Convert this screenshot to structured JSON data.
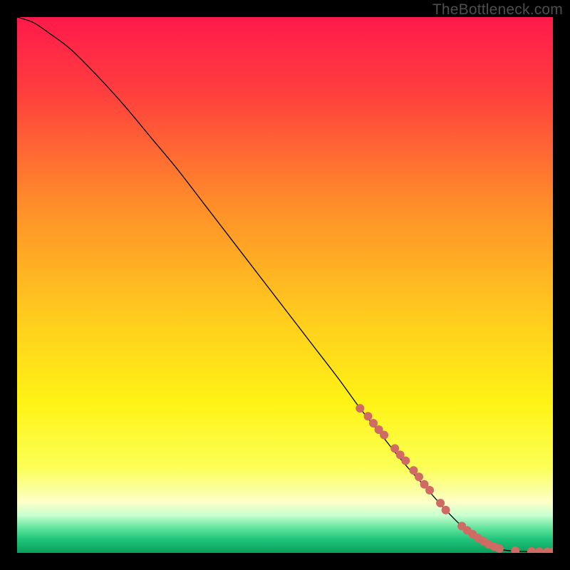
{
  "branding": {
    "watermark": "TheBottleneck.com"
  },
  "chart_data": {
    "type": "line",
    "title": "",
    "xlabel": "",
    "ylabel": "",
    "xlim": [
      0,
      100
    ],
    "ylim": [
      0,
      100
    ],
    "grid": false,
    "legend": false,
    "background": {
      "type": "vertical-gradient",
      "stops": [
        {
          "offset": 0.0,
          "color": "#ff1a4b"
        },
        {
          "offset": 0.14,
          "color": "#ff3e3e"
        },
        {
          "offset": 0.34,
          "color": "#ff8a2a"
        },
        {
          "offset": 0.55,
          "color": "#ffc91e"
        },
        {
          "offset": 0.72,
          "color": "#fff315"
        },
        {
          "offset": 0.84,
          "color": "#fbff55"
        },
        {
          "offset": 0.905,
          "color": "#fdffc8"
        },
        {
          "offset": 0.93,
          "color": "#c8ffd0"
        },
        {
          "offset": 0.955,
          "color": "#5ce29a"
        },
        {
          "offset": 0.975,
          "color": "#1fc47a"
        },
        {
          "offset": 1.0,
          "color": "#0a9f5b"
        }
      ]
    },
    "series": [
      {
        "name": "bottleneck-curve",
        "color": "#000000",
        "stroke_width": 1.3,
        "x": [
          0,
          3,
          6,
          10,
          15,
          20,
          25,
          30,
          35,
          40,
          45,
          50,
          55,
          60,
          64,
          68,
          72,
          76,
          80,
          83,
          85,
          88,
          90,
          92,
          94,
          96,
          98,
          100
        ],
        "y": [
          100,
          99,
          97,
          94,
          89,
          83.5,
          77.5,
          71.5,
          65,
          58.5,
          52,
          45.5,
          39,
          32.5,
          27,
          22,
          17,
          12.5,
          8,
          5,
          3.5,
          1.5,
          0.7,
          0.4,
          0.3,
          0.25,
          0.2,
          0.2
        ]
      }
    ],
    "markers": {
      "name": "highlighted-range-dots",
      "color": "#cf6b63",
      "radius": 6,
      "x": [
        64,
        65.5,
        66.5,
        67.5,
        68.5,
        70.5,
        71.5,
        72.5,
        74,
        75,
        76,
        77,
        79,
        80,
        83,
        84,
        85,
        86,
        87,
        88,
        89,
        90,
        93,
        96,
        97.5,
        99,
        100
      ],
      "y": [
        27,
        25.5,
        24.2,
        23.0,
        22.0,
        19.5,
        18.3,
        17.2,
        15.4,
        14.2,
        12.8,
        11.7,
        9.3,
        8.0,
        5.0,
        4.2,
        3.5,
        2.8,
        2.2,
        1.6,
        1.2,
        0.8,
        0.4,
        0.28,
        0.25,
        0.22,
        0.2
      ]
    }
  }
}
